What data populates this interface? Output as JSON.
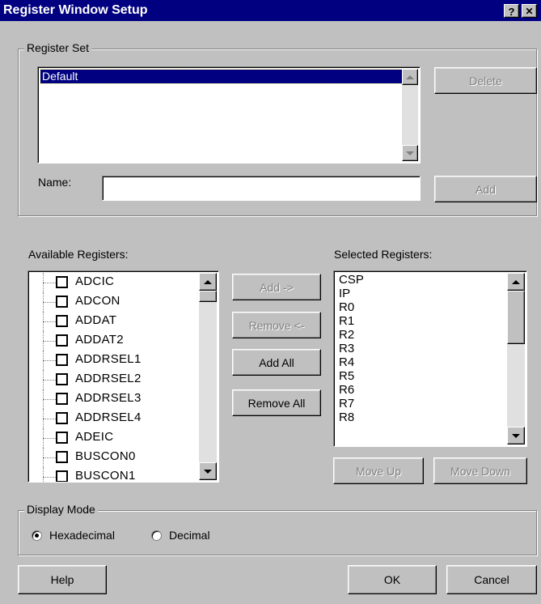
{
  "window": {
    "title": "Register Window Setup",
    "help_glyph": "?",
    "close_glyph": "✕"
  },
  "register_set": {
    "group_label": "Register Set",
    "items": [
      {
        "label": "Default",
        "selected": true
      }
    ],
    "delete_label": "Delete",
    "name_label": "Name:",
    "name_value": "",
    "add_label": "Add"
  },
  "available": {
    "label": "Available Registers:",
    "items": [
      "ADCIC",
      "ADCON",
      "ADDAT",
      "ADDAT2",
      "ADDRSEL1",
      "ADDRSEL2",
      "ADDRSEL3",
      "ADDRSEL4",
      "ADEIC",
      "BUSCON0",
      "BUSCON1"
    ]
  },
  "middle_buttons": {
    "add": "Add ->",
    "remove": "Remove <-",
    "add_all": "Add All",
    "remove_all": "Remove All"
  },
  "selected": {
    "label": "Selected Registers:",
    "items": [
      "CSP",
      "IP",
      "R0",
      "R1",
      "R2",
      "R3",
      "R4",
      "R5",
      "R6",
      "R7",
      "R8"
    ],
    "move_up": "Move Up",
    "move_down": "Move Down"
  },
  "display_mode": {
    "group_label": "Display Mode",
    "hex_label": "Hexadecimal",
    "dec_label": "Decimal",
    "selected": "Hexadecimal"
  },
  "footer": {
    "help": "Help",
    "ok": "OK",
    "cancel": "Cancel"
  },
  "colors": {
    "titlebar": "#000080",
    "face": "#c0c0c0",
    "selection": "#000080"
  }
}
